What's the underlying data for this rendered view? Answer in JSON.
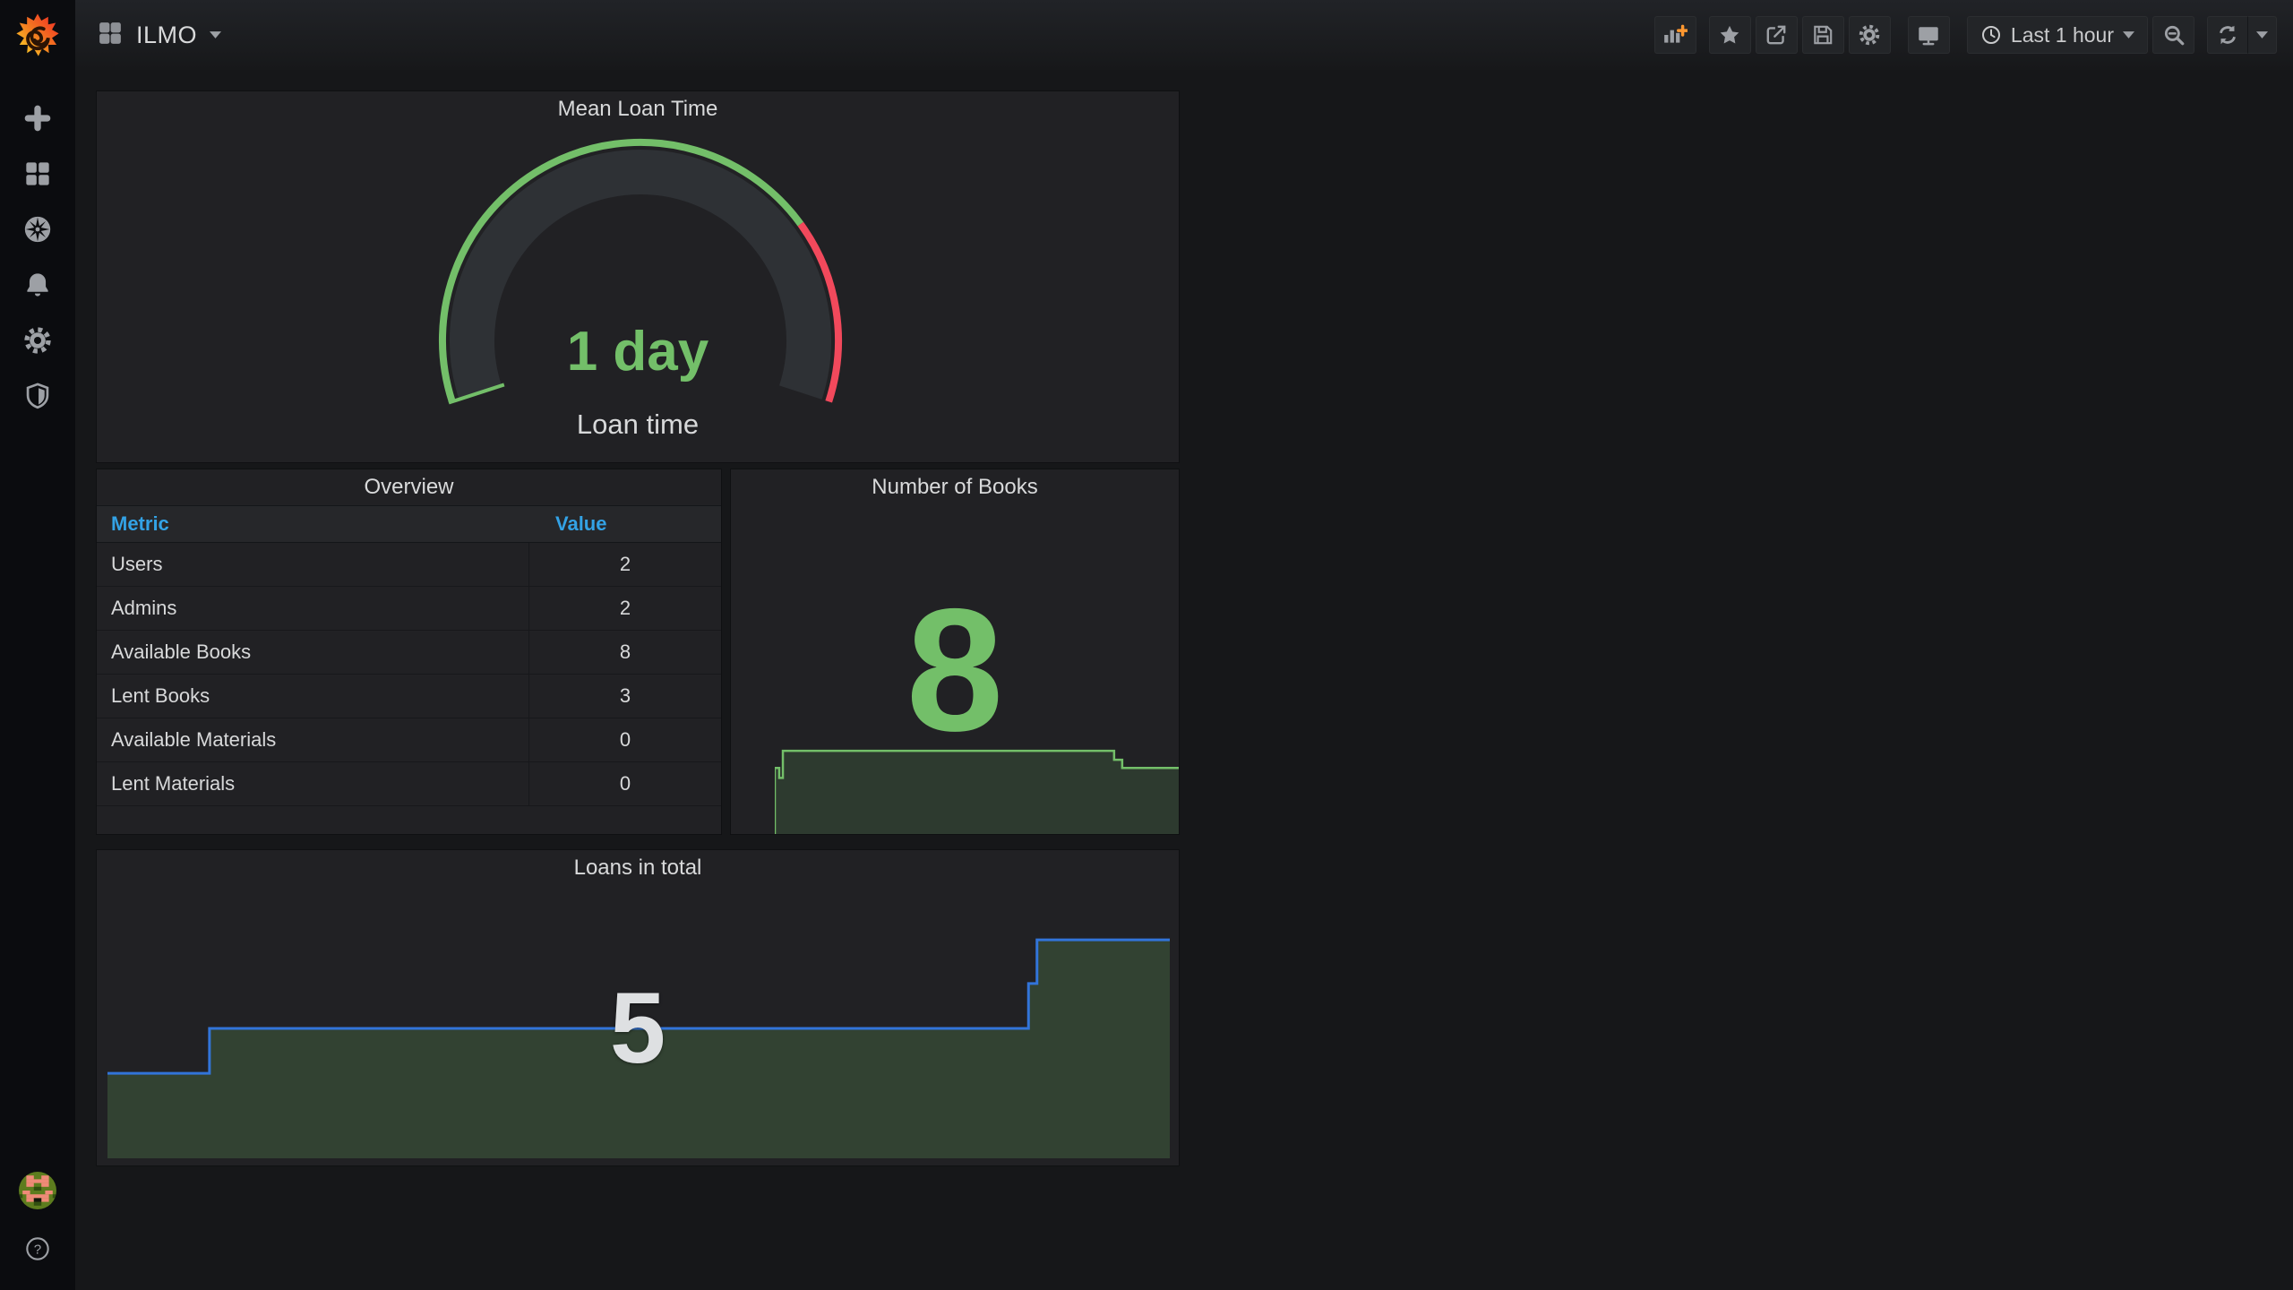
{
  "app": {
    "name": "Grafana"
  },
  "colors": {
    "page_bg": "#161719",
    "panel_bg": "#212124",
    "sidebar_bg": "#0b0c0f",
    "text": "#d8d9da",
    "icon_gray": "#9da0a5",
    "green": "#73BF69",
    "red": "#F2495C",
    "blue_line": "#3274D9",
    "table_header_blue": "#33A2E5",
    "add_panel_plus_orange": "#FF9830"
  },
  "sidebar": {
    "icons": [
      {
        "name": "grafana-logo"
      },
      {
        "name": "create-plus-icon"
      },
      {
        "name": "dashboards-icon"
      },
      {
        "name": "explore-compass-icon"
      },
      {
        "name": "alerting-bell-icon"
      },
      {
        "name": "configuration-gear-icon"
      },
      {
        "name": "server-admin-shield-icon"
      },
      {
        "name": "user-avatar"
      },
      {
        "name": "help-question-icon"
      }
    ]
  },
  "navbar": {
    "dashboard_icon": "apps-grid-icon",
    "dashboard_title": "ILMO",
    "title_caret": "caret-down-icon",
    "toolbar_icons": [
      {
        "name": "add-panel-icon"
      },
      {
        "name": "star-icon"
      },
      {
        "name": "share-icon"
      },
      {
        "name": "save-icon"
      },
      {
        "name": "settings-gear-icon"
      },
      {
        "name": "tv-monitor-icon"
      },
      {
        "name": "clock-icon"
      },
      {
        "name": "zoom-out-icon"
      },
      {
        "name": "refresh-icon"
      },
      {
        "name": "caret-down-icon"
      }
    ],
    "time_picker": {
      "label": "Last 1 hour"
    }
  },
  "panels": {
    "gauge": {
      "title": "Mean Loan Time",
      "value": "1 day",
      "label": "Loan time"
    },
    "overview": {
      "title": "Overview",
      "columns": [
        "Metric",
        "Value"
      ],
      "rows": [
        [
          "Users",
          "2"
        ],
        [
          "Admins",
          "2"
        ],
        [
          "Available Books",
          "8"
        ],
        [
          "Lent Books",
          "3"
        ],
        [
          "Available Materials",
          "0"
        ],
        [
          "Lent Materials",
          "0"
        ]
      ]
    },
    "books": {
      "title": "Number of Books",
      "value": "8"
    },
    "loans": {
      "title": "Loans in total",
      "value": "5"
    }
  },
  "chart_data": [
    {
      "type": "gauge",
      "title": "Mean Loan Time",
      "value_text": "1 day",
      "value_numeric": 1,
      "unit": "day",
      "sweep_deg": 216,
      "start_angle_deg": 198,
      "thresholds": [
        {
          "color": "#73BF69",
          "from_frac": 0,
          "to_frac": 0.75
        },
        {
          "color": "#F2495C",
          "from_frac": 0.75,
          "to_frac": 1.0
        }
      ],
      "value_frac": 0
    },
    {
      "type": "area",
      "title": "Number of Books",
      "current": 8,
      "values_over_time_estimate": [
        0,
        7,
        8,
        8,
        8,
        8,
        8,
        8,
        7.5,
        7,
        7
      ],
      "line_color": "#73BF69",
      "fill_color": "rgba(115,191,105,0.16)",
      "render": {
        "target": "books-svg",
        "stroke_width": 2.5,
        "line_points": [
          [
            0,
            100
          ],
          [
            0,
            27
          ],
          [
            1.1,
            27
          ],
          [
            1.1,
            38
          ],
          [
            2,
            38
          ],
          [
            2,
            8
          ],
          [
            84,
            8
          ],
          [
            84,
            18
          ],
          [
            86,
            18
          ],
          [
            86,
            27
          ],
          [
            100,
            27
          ]
        ]
      }
    },
    {
      "type": "area",
      "title": "Loans in total",
      "current": 5,
      "values_over_time_estimate": [
        3,
        3,
        4,
        4,
        4,
        4,
        4,
        4,
        4,
        4.5,
        5,
        5
      ],
      "line_color": "#3274D9",
      "fill_color": "rgba(115,191,105,0.21)",
      "render": {
        "target": "loans-svg",
        "stroke_width": 3,
        "line_points": [
          [
            0,
            62.5
          ],
          [
            9.6,
            62.5
          ],
          [
            9.6,
            42.7
          ],
          [
            86.7,
            42.7
          ],
          [
            86.7,
            22.9
          ],
          [
            87.5,
            22.9
          ],
          [
            87.5,
            3.6
          ],
          [
            100,
            3.6
          ]
        ]
      }
    }
  ]
}
